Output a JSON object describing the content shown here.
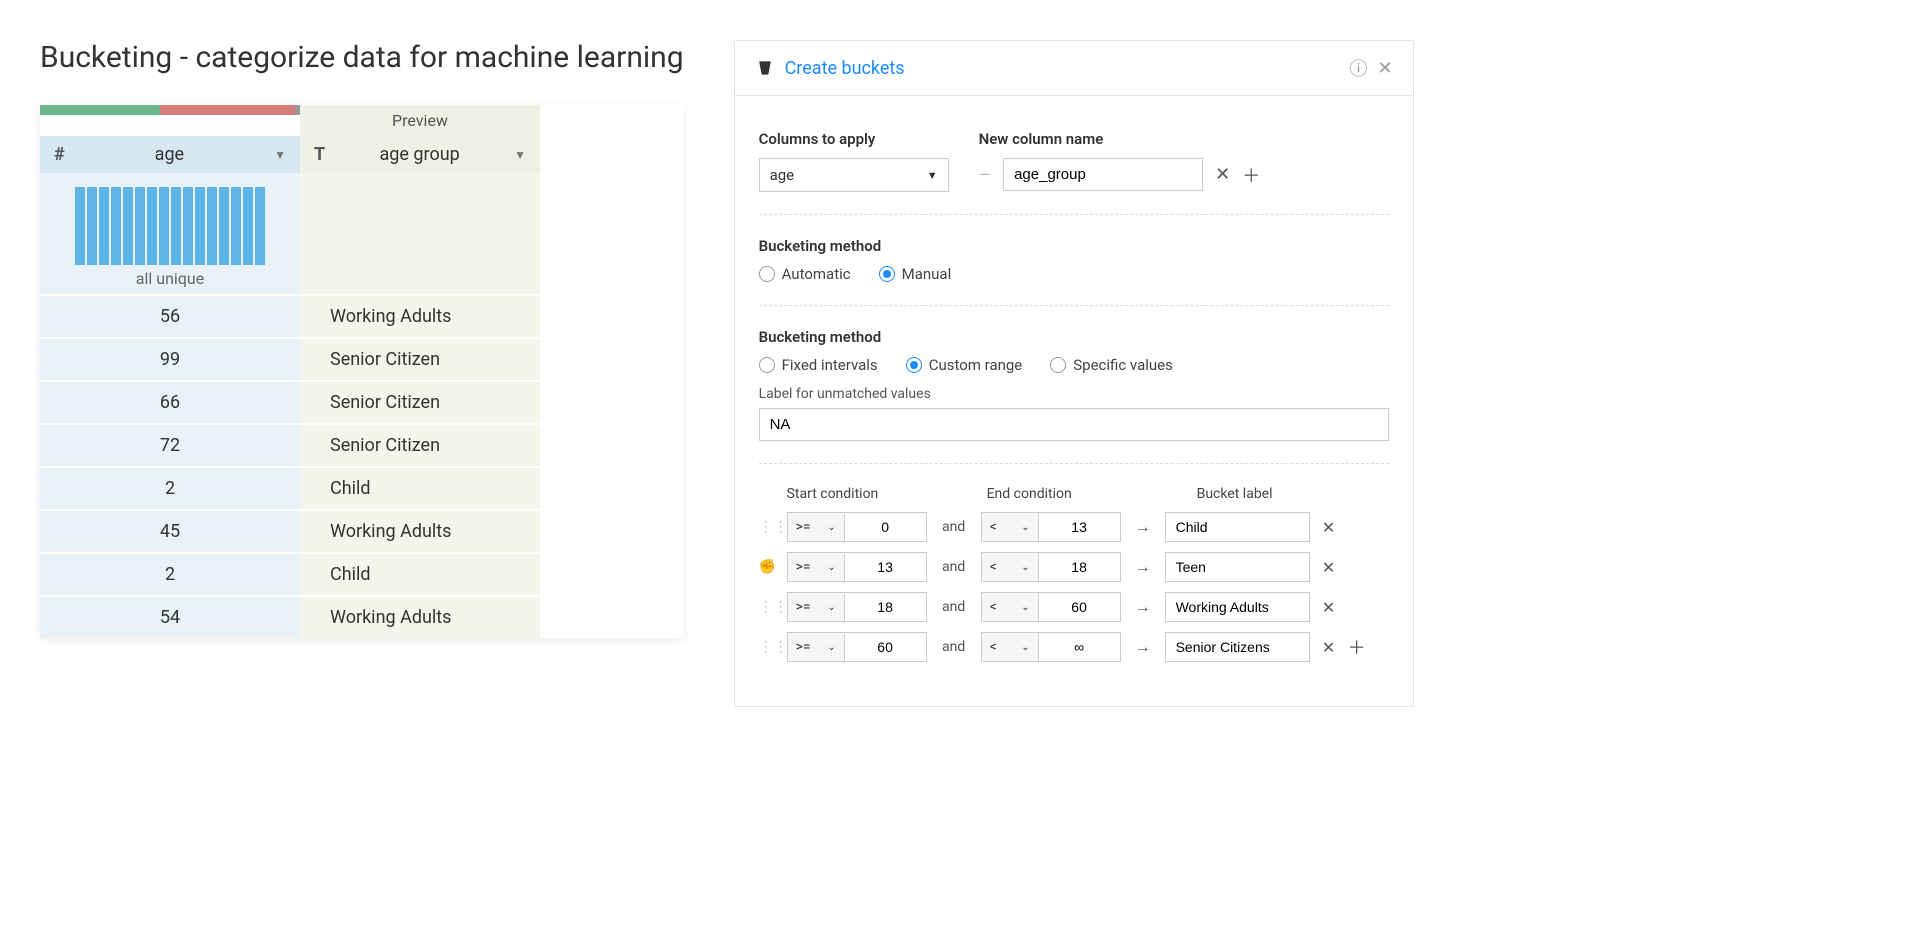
{
  "page_title": "Bucketing - categorize data for machine learning",
  "table": {
    "preview_label": "Preview",
    "columns": [
      {
        "type_symbol": "#",
        "name": "age"
      },
      {
        "type_symbol": "T",
        "name": "age group"
      }
    ],
    "histogram_label": "all unique",
    "rows": [
      {
        "age": "56",
        "group": "Working Adults"
      },
      {
        "age": "99",
        "group": "Senior Citizen"
      },
      {
        "age": "66",
        "group": "Senior Citizen"
      },
      {
        "age": "72",
        "group": "Senior Citizen"
      },
      {
        "age": "2",
        "group": "Child"
      },
      {
        "age": "45",
        "group": "Working Adults"
      },
      {
        "age": "2",
        "group": "Child"
      },
      {
        "age": "54",
        "group": "Working Adults"
      }
    ]
  },
  "panel": {
    "title": "Create buckets",
    "columns_label": "Columns to apply",
    "new_column_label": "New column name",
    "column_value": "age",
    "new_column_value": "age_group",
    "method_label": "Bucketing method",
    "method_automatic": "Automatic",
    "method_manual": "Manual",
    "submethod_label": "Bucketing method",
    "submethod_fixed": "Fixed intervals",
    "submethod_custom": "Custom range",
    "submethod_specific": "Specific values",
    "unmatched_label": "Label for unmatched values",
    "unmatched_value": "NA",
    "cond_headers": {
      "start": "Start condition",
      "end": "End condition",
      "label": "Bucket label"
    },
    "and_text": "and",
    "arrow": "→",
    "rows": [
      {
        "start_op": ">=",
        "start_val": "0",
        "end_op": "<",
        "end_val": "13",
        "label": "Child"
      },
      {
        "start_op": ">=",
        "start_val": "13",
        "end_op": "<",
        "end_val": "18",
        "label": "Teen"
      },
      {
        "start_op": ">=",
        "start_val": "18",
        "end_op": "<",
        "end_val": "60",
        "label": "Working Adults"
      },
      {
        "start_op": ">=",
        "start_val": "60",
        "end_op": "<",
        "end_val": "∞",
        "label": "Senior Citizens"
      }
    ]
  }
}
